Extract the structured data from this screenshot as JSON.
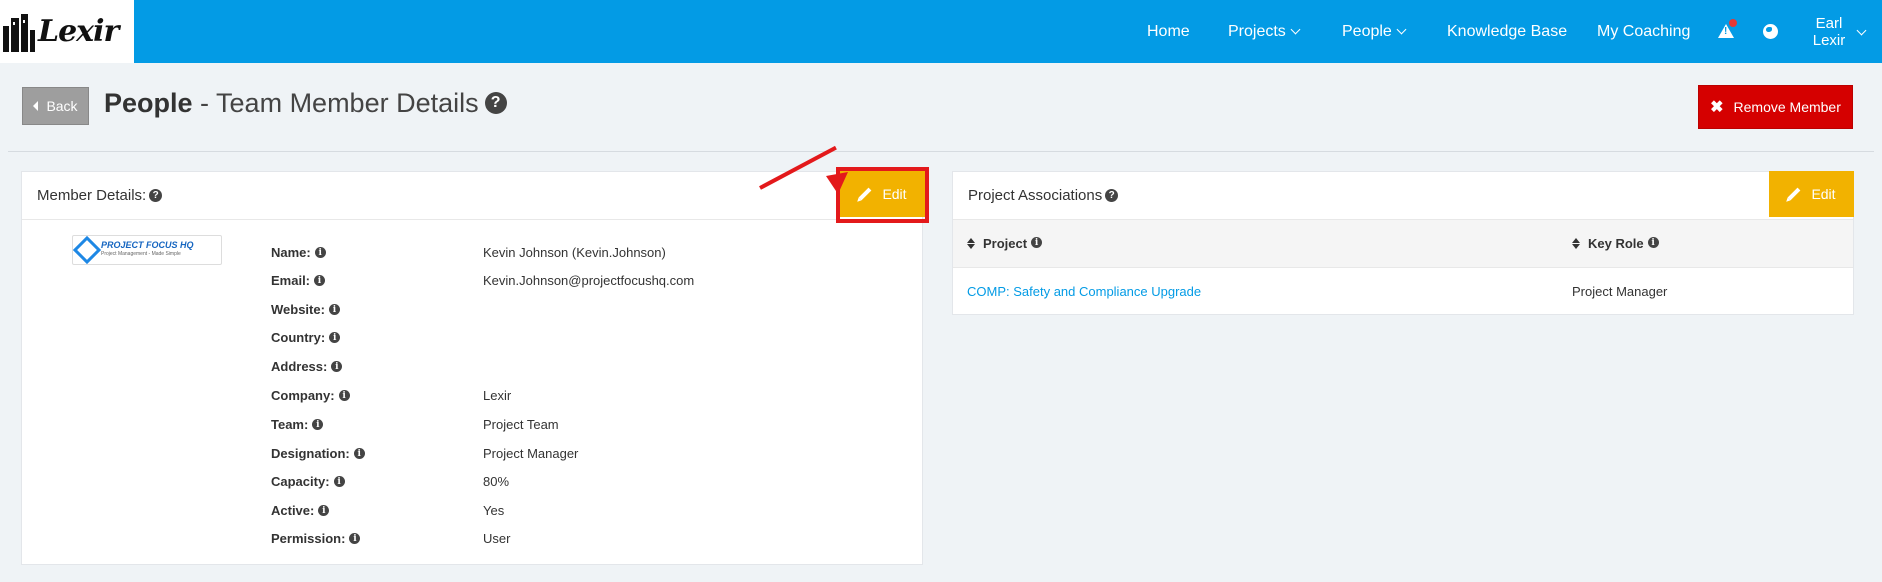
{
  "app": {
    "logo_text": "Lexir"
  },
  "nav": {
    "home": "Home",
    "projects": "Projects",
    "people": "People",
    "knowledge_base": "Knowledge Base",
    "my_coaching": "My Coaching",
    "user_first": "Earl",
    "user_last": "Lexir"
  },
  "header": {
    "back_label": "Back",
    "title_bold": "People",
    "title_rest": " - Team Member Details",
    "remove_label": "Remove Member"
  },
  "member_panel": {
    "title": "Member Details:",
    "edit_label": "Edit",
    "logo": {
      "wordmark": "PROJECT FOCUS HQ",
      "tagline": "Project Management - Made Simple"
    },
    "fields": [
      {
        "label": "Name:",
        "value": "Kevin Johnson (Kevin.Johnson)"
      },
      {
        "label": "Email:",
        "value": "Kevin.Johnson@projectfocushq.com"
      },
      {
        "label": "Website:",
        "value": ""
      },
      {
        "label": "Country:",
        "value": ""
      },
      {
        "label": "Address:",
        "value": ""
      },
      {
        "label": "Company:",
        "value": "Lexir"
      },
      {
        "label": "Team:",
        "value": "Project Team"
      },
      {
        "label": "Designation:",
        "value": "Project Manager"
      },
      {
        "label": "Capacity:",
        "value": "80%"
      },
      {
        "label": "Active:",
        "value": "Yes"
      },
      {
        "label": "Permission:",
        "value": "User"
      }
    ]
  },
  "associations_panel": {
    "title": "Project Associations",
    "edit_label": "Edit",
    "columns": [
      "Project",
      "Key Role"
    ],
    "rows": [
      {
        "project": "COMP: Safety and Compliance Upgrade",
        "key_role": "Project Manager"
      }
    ]
  },
  "colors": {
    "topbar": "#039be5",
    "remove": "#d50000",
    "edit": "#f2b200",
    "highlight": "#e3191b",
    "link": "#039be5"
  },
  "icons": [
    "building-logo-icon",
    "alert-icon",
    "globe-icon",
    "chevron-down-icon",
    "help-icon",
    "info-icon",
    "pencil-icon",
    "close-icon",
    "sort-icon"
  ]
}
